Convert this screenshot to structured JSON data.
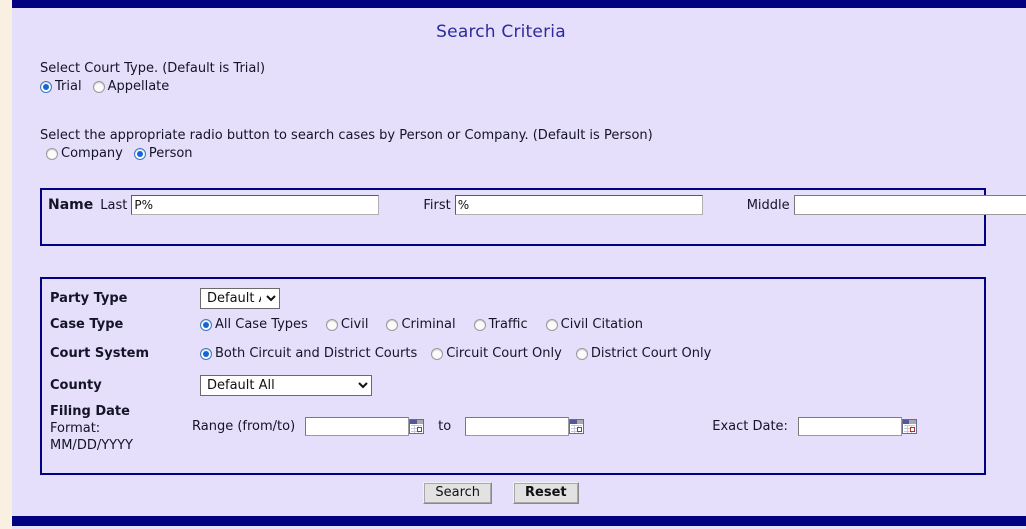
{
  "page": {
    "title": "Search Criteria",
    "accent_navy": "#000080",
    "bg_lavender": "#e6dffb",
    "bg_outer": "#faf0e1"
  },
  "court_type": {
    "instruction": "Select Court Type. (Default is Trial)",
    "options": [
      {
        "label": "Trial",
        "checked": true
      },
      {
        "label": "Appellate",
        "checked": false
      }
    ]
  },
  "party_scope": {
    "instruction": "Select the appropriate radio button to search cases by Person or Company. (Default is Person)",
    "options": [
      {
        "label": "Company",
        "checked": false
      },
      {
        "label": "Person",
        "checked": true
      }
    ]
  },
  "name_panel": {
    "heading": "Name",
    "last": {
      "label": "Last",
      "value": "P%",
      "placeholder": ""
    },
    "first": {
      "label": "First",
      "value": "%",
      "placeholder": ""
    },
    "middle": {
      "label": "Middle",
      "value": "",
      "placeholder": ""
    }
  },
  "criteria": {
    "party_type": {
      "label": "Party Type",
      "selected": "Default All",
      "options": [
        "Default All"
      ]
    },
    "case_type": {
      "label": "Case Type",
      "options": [
        {
          "label": "All Case Types",
          "checked": true
        },
        {
          "label": "Civil",
          "checked": false
        },
        {
          "label": "Criminal",
          "checked": false
        },
        {
          "label": "Traffic",
          "checked": false
        },
        {
          "label": "Civil Citation",
          "checked": false
        }
      ]
    },
    "court_system": {
      "label": "Court System",
      "options": [
        {
          "label": "Both Circuit and District Courts",
          "checked": true
        },
        {
          "label": "Circuit Court Only",
          "checked": false
        },
        {
          "label": "District Court Only",
          "checked": false
        }
      ]
    },
    "county": {
      "label": "County",
      "selected": "Default All",
      "options": [
        "Default All"
      ]
    },
    "filing_date": {
      "label": "Filing Date",
      "format_line1": "Format:",
      "format_line2": "MM/DD/YYYY",
      "range_label": "Range (from/to)",
      "to_label": "to",
      "exact_label": "Exact Date:",
      "range_from_value": "",
      "range_to_value": "",
      "exact_value": "",
      "calendar_icon": "calendar-icon"
    }
  },
  "actions": {
    "search_label": "Search",
    "reset_label": "Reset"
  }
}
